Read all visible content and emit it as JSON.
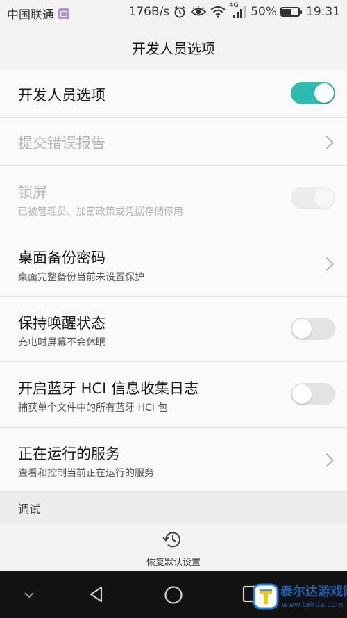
{
  "status_bar": {
    "carrier": "中国联通",
    "speed": "176B/s",
    "network": "4G",
    "battery": "50%",
    "time": "19:31"
  },
  "title_bar": {
    "title": "开发人员选项"
  },
  "rows": [
    {
      "title": "开发人员选项",
      "control": "toggle",
      "state": "on"
    },
    {
      "title": "提交错误报告",
      "control": "chevron",
      "state": "disabled"
    },
    {
      "title": "锁屏",
      "subtitle": "已被管理员、加密政策或凭据存储停用",
      "control": "toggle",
      "state": "disabled"
    },
    {
      "title": "桌面备份密码",
      "subtitle": "桌面完整备份当前未设置保护",
      "control": "chevron"
    },
    {
      "title": "保持唤醒状态",
      "subtitle": "充电时屏幕不会休眠",
      "control": "toggle",
      "state": "off"
    },
    {
      "title": "开启蓝牙 HCI 信息收集日志",
      "subtitle": "捕获单个文件中的所有蓝牙 HCI 包",
      "control": "toggle",
      "state": "off"
    },
    {
      "title": "正在运行的服务",
      "subtitle": "查看和控制当前正在运行的服务",
      "control": "chevron"
    }
  ],
  "section_header": "调试",
  "bottom_action": {
    "label": "恢复默认设置",
    "icon": "restore-history-icon"
  },
  "nav_bar": {
    "icons": [
      "hide-nav-chevron-icon",
      "back-icon",
      "home-icon",
      "recents-icon"
    ]
  },
  "watermark": {
    "text": "泰尔达游戏网",
    "url": "www.tairda.com"
  },
  "colors": {
    "accent": "#2bbbb0",
    "background": "#fafafa",
    "navbar": "#121212"
  }
}
